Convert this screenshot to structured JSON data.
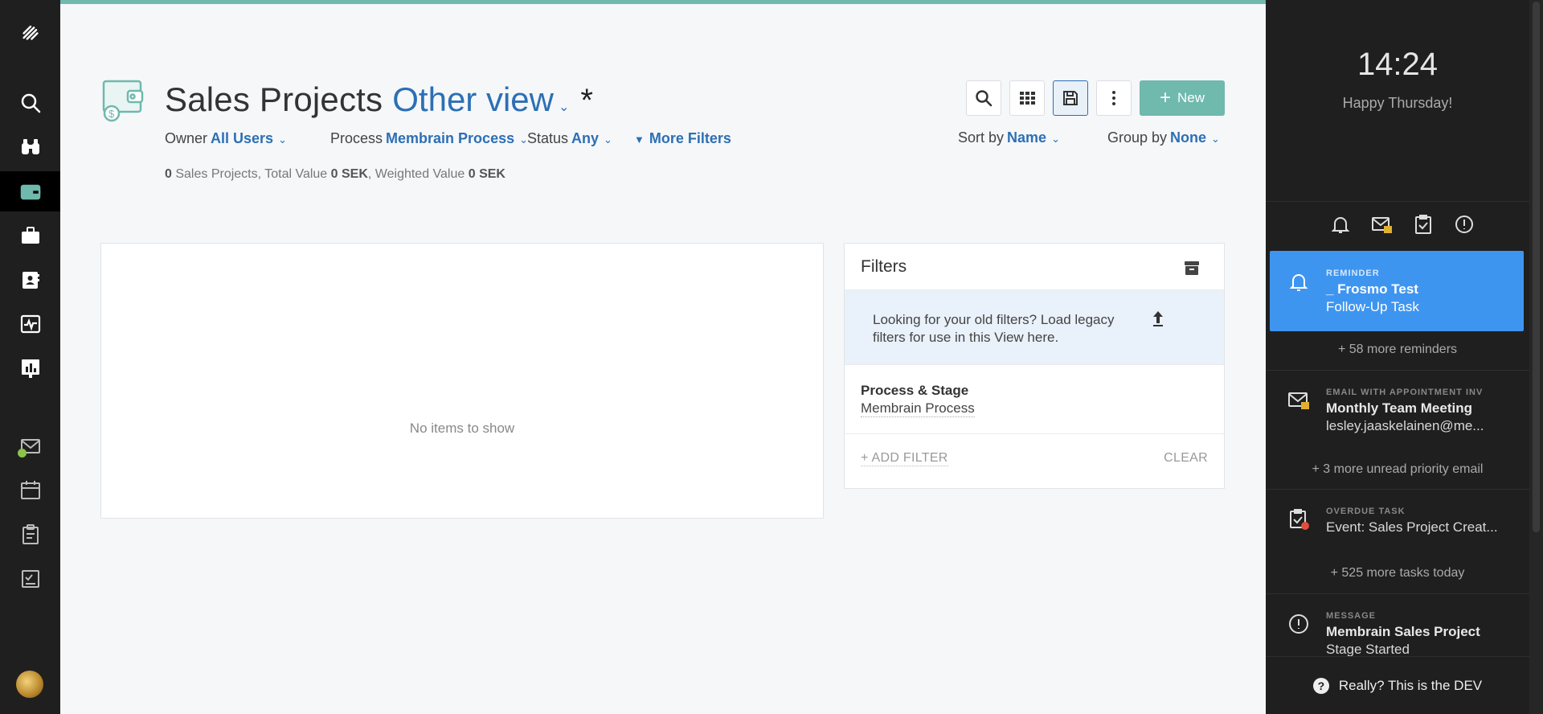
{
  "nav": {
    "items": [
      {
        "icon": "logo-icon"
      },
      {
        "icon": "search-icon"
      },
      {
        "icon": "binoculars-icon"
      },
      {
        "icon": "wallet-icon"
      },
      {
        "icon": "briefcase-icon"
      },
      {
        "icon": "contacts-icon"
      },
      {
        "icon": "activity-icon"
      },
      {
        "icon": "report-icon"
      },
      {
        "icon": "mail-icon"
      },
      {
        "icon": "calendar-icon"
      },
      {
        "icon": "clipboard-icon"
      },
      {
        "icon": "checklist-icon"
      }
    ],
    "accent": "#6fb9ad"
  },
  "header": {
    "title": "Sales Projects",
    "view_name": "Other view",
    "view_chevron": "⌄",
    "modified_marker": "*"
  },
  "filters": {
    "owner": {
      "label": "Owner",
      "value": "All Users"
    },
    "process": {
      "label": "Process",
      "value": "Membrain Process"
    },
    "status": {
      "label": "Status",
      "value": "Any"
    },
    "more": {
      "label": "More Filters"
    }
  },
  "sort": {
    "sort_by": {
      "label": "Sort by",
      "value": "Name"
    },
    "group_by": {
      "label": "Group by",
      "value": "None"
    }
  },
  "summary": {
    "count": "0",
    "count_label": "Sales Projects, Total Value",
    "total_value": "0 SEK",
    "weighted_label": ", Weighted Value",
    "weighted_value": "0 SEK"
  },
  "toolbar": {
    "new_label": "New"
  },
  "list": {
    "empty_text": "No items to show"
  },
  "filters_panel": {
    "title": "Filters",
    "legacy_text": "Looking for your old filters? Load legacy filters for use in this View here.",
    "stage_title": "Process & Stage",
    "stage_value": "Membrain Process",
    "add_filter": "+ ADD FILTER",
    "clear": "CLEAR"
  },
  "right_panel": {
    "time": "14:24",
    "greeting": "Happy Thursday!",
    "cards": [
      {
        "type": "REMINDER",
        "title": "_ Frosmo Test",
        "subtitle": "Follow-Up Task"
      },
      {
        "type": "EMAIL WITH APPOINTMENT INV",
        "title": "Monthly Team Meeting",
        "subtitle": "lesley.jaaskelainen@me..."
      },
      {
        "type": "OVERDUE TASK",
        "title": "",
        "subtitle": "Event: Sales Project Creat..."
      },
      {
        "type": "MESSAGE",
        "title": "Membrain Sales Project",
        "subtitle": "Stage Started"
      }
    ],
    "more": [
      "+ 58 more reminders",
      "+ 3 more unread priority email",
      "+ 525 more tasks today"
    ],
    "footer": "Really? This is the DEV",
    "active_color": "#3e95f0"
  }
}
